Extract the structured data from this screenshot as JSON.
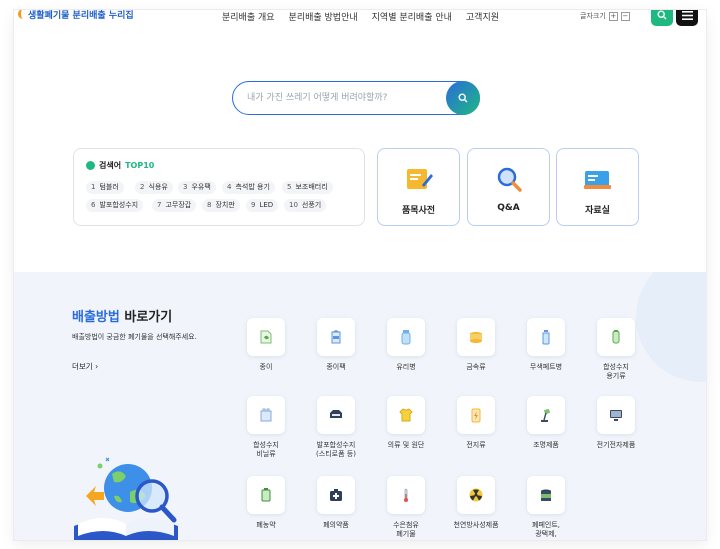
{
  "header": {
    "logo_text": "생활폐기물 분리배출 누리집",
    "nav": [
      "분리배출 개요",
      "분리배출 방법안내",
      "지역별 분리배출 안내",
      "고객지원"
    ],
    "font_size_label": "글자크기",
    "font_plus": "+",
    "font_minus": "−"
  },
  "search": {
    "placeholder": "내가 가진 쓰레기 어떻게 버려야할까?"
  },
  "top10": {
    "title_prefix": "검색어",
    "title_accent": "TOP10",
    "keywords": [
      {
        "rank": "1",
        "label": "텀블러"
      },
      {
        "rank": "2",
        "label": "식용유"
      },
      {
        "rank": "3",
        "label": "우유팩"
      },
      {
        "rank": "4",
        "label": "측석밥 용기"
      },
      {
        "rank": "5",
        "label": "보조배터리"
      },
      {
        "rank": "6",
        "label": "발포합성수지"
      },
      {
        "rank": "7",
        "label": "고무장갑"
      },
      {
        "rank": "8",
        "label": "장치판"
      },
      {
        "rank": "9",
        "label": "LED"
      },
      {
        "rank": "10",
        "label": "선풍기"
      }
    ]
  },
  "quick_links": [
    {
      "label": "품목사전",
      "icon": "dictionary-icon"
    },
    {
      "label": "Q&A",
      "icon": "magnifier-icon"
    },
    {
      "label": "자료실",
      "icon": "archive-icon"
    }
  ],
  "disposal": {
    "title_accent": "배출방법",
    "title_rest": "바로가기",
    "subtitle": "배출방법이 궁금한 폐기물을 선택해주세요.",
    "more": "더보기 ›",
    "categories": [
      {
        "label": "종이",
        "icon": "paper-icon"
      },
      {
        "label": "종이팩",
        "icon": "paper-pack-icon"
      },
      {
        "label": "유리병",
        "icon": "glass-bottle-icon"
      },
      {
        "label": "금속류",
        "icon": "metal-can-icon"
      },
      {
        "label": "무색페트병",
        "icon": "pet-bottle-icon"
      },
      {
        "label": "합성수지\n용기류",
        "icon": "plastic-tube-icon"
      },
      {
        "label": "합성수지\n비닐류",
        "icon": "vinyl-bag-icon"
      },
      {
        "label": "발포합성수지\n(스티로폼 등)",
        "icon": "styrofoam-icon"
      },
      {
        "label": "의류 및 원단",
        "icon": "clothing-icon"
      },
      {
        "label": "전지류",
        "icon": "battery-icon"
      },
      {
        "label": "조명제품",
        "icon": "lamp-icon"
      },
      {
        "label": "전기전자제품",
        "icon": "monitor-icon"
      },
      {
        "label": "폐농약",
        "icon": "pesticide-icon"
      },
      {
        "label": "폐의약품",
        "icon": "medicine-kit-icon"
      },
      {
        "label": "수은첨유\n폐기물",
        "icon": "thermometer-icon"
      },
      {
        "label": "천연방사성제품",
        "icon": "radiation-icon"
      },
      {
        "label": "폐페인트,\n광택제,",
        "icon": "paint-can-icon"
      }
    ]
  },
  "colors": {
    "primary_blue": "#2b6cdb",
    "accent_green": "#1eb980",
    "section_bg": "#f1f5fb"
  }
}
